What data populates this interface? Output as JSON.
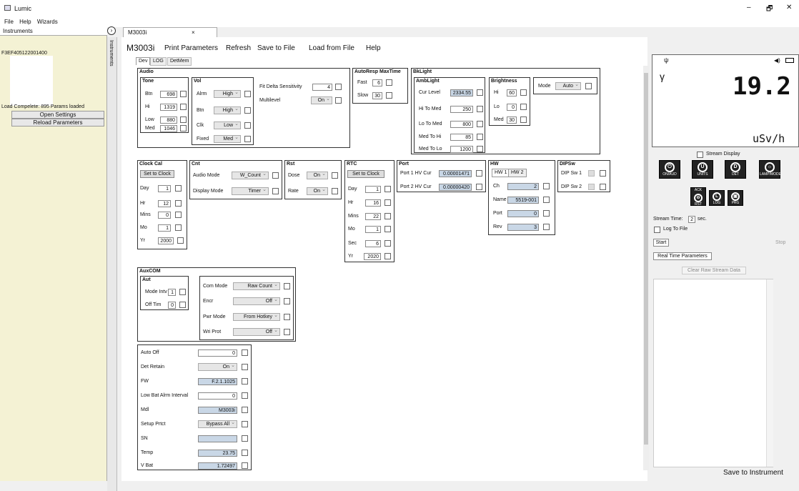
{
  "window": {
    "title": "Lumic",
    "minimize": "–",
    "restore": "🗗",
    "close": "✕"
  },
  "menu": [
    "File",
    "Help",
    "Wizards"
  ],
  "left": {
    "header": "Instruments",
    "serial": "F3EF405122001400",
    "status": "Load Compelete: 895 Params loaded",
    "open_settings": "Open Settings",
    "reload": "Reload Parameters",
    "strip_label": "Instruments"
  },
  "doc_tab": {
    "label": "M3003i",
    "close": "×"
  },
  "toolbar": {
    "model": "M3003i",
    "print": "Print Parameters",
    "refresh": "Refresh",
    "save_file": "Save to File",
    "load_file": "Load from File",
    "help": "Help"
  },
  "subtabs": [
    "Dev",
    "LOG",
    "DetMem"
  ],
  "audio": {
    "title": "Audio",
    "tone": {
      "title": "Tone",
      "rows": [
        {
          "label": "Btn",
          "value": "698"
        },
        {
          "label": "Hi",
          "value": "1319"
        },
        {
          "label": "Low",
          "value": "880"
        },
        {
          "label": "Med",
          "value": "1046"
        }
      ]
    },
    "vol": {
      "title": "Vol",
      "rows": [
        {
          "label": "Alrm",
          "value": "High"
        },
        {
          "label": "Btn",
          "value": "High"
        },
        {
          "label": "Clk",
          "value": "Low"
        },
        {
          "label": "Fixed",
          "value": "Med"
        }
      ]
    },
    "fit": {
      "label": "Fit Delta Sensitivity",
      "value": "4"
    },
    "multilevel": {
      "label": "Multilevel",
      "value": "On"
    }
  },
  "autoresp": {
    "title": "AutoResp MaxTime",
    "fast": {
      "label": "Fast",
      "value": "6"
    },
    "slow": {
      "label": "Slow",
      "value": "30"
    }
  },
  "bklight": {
    "title": "BkLight",
    "amb": {
      "title": "AmbLight",
      "rows": [
        {
          "label": "Cur Level",
          "value": "2334.55"
        },
        {
          "label": "Hi To Med",
          "value": "250"
        },
        {
          "label": "Lo To Med",
          "value": "800"
        },
        {
          "label": "Med To Hi",
          "value": "85"
        },
        {
          "label": "Med To Lo",
          "value": "1200"
        }
      ]
    },
    "bright": {
      "title": "Brightness",
      "rows": [
        {
          "label": "Hi",
          "value": "60"
        },
        {
          "label": "Lo",
          "value": "0"
        },
        {
          "label": "Med",
          "value": "30"
        }
      ]
    },
    "mode": {
      "label": "Mode",
      "value": "Auto"
    }
  },
  "clock": {
    "title": "Clock Cal",
    "set": "Set to Clock",
    "rows": [
      {
        "label": "Day",
        "value": "1"
      },
      {
        "label": "Hr",
        "value": "12"
      },
      {
        "label": "Mins",
        "value": "0"
      },
      {
        "label": "Mo",
        "value": "1"
      },
      {
        "label": "Yr",
        "value": "2000"
      }
    ]
  },
  "cnt": {
    "title": "Cnt",
    "audio": {
      "label": "Audio Mode",
      "value": "W_Count"
    },
    "display": {
      "label": "Display Mode",
      "value": "Timer"
    }
  },
  "rst": {
    "title": "Rst",
    "dose": {
      "label": "Dose",
      "value": "On"
    },
    "rate": {
      "label": "Rate",
      "value": "On"
    }
  },
  "rtc": {
    "title": "RTC",
    "set": "Set to Clock",
    "rows": [
      {
        "label": "Day",
        "value": "1"
      },
      {
        "label": "Hr",
        "value": "16"
      },
      {
        "label": "Mins",
        "value": "22"
      },
      {
        "label": "Mo",
        "value": "1"
      },
      {
        "label": "Sec",
        "value": "6"
      },
      {
        "label": "Yr",
        "value": "2020"
      }
    ]
  },
  "port": {
    "title": "Port",
    "p1": {
      "label": "Port 1 HV Cur",
      "value": "0.00001471"
    },
    "p2": {
      "label": "Port 2 HV Cur",
      "value": "0.00000420"
    }
  },
  "hw": {
    "title": "HW",
    "tab1": "HW 1",
    "tab2": "HW 2",
    "rows": [
      {
        "label": "Ch",
        "value": "2"
      },
      {
        "label": "Name",
        "value": "5519-001"
      },
      {
        "label": "Port",
        "value": "0"
      },
      {
        "label": "Rev",
        "value": "3"
      }
    ]
  },
  "dipsw": {
    "title": "DIPSw",
    "rows": [
      {
        "label": "DIP Sw 1"
      },
      {
        "label": "DIP Sw 2"
      }
    ]
  },
  "auxcom": {
    "title": "AuxCOM",
    "aut": {
      "title": "Aut",
      "mode": {
        "label": "Mode Intv",
        "value": "1"
      },
      "off": {
        "label": "Off Tim",
        "value": "0"
      }
    },
    "com": {
      "label": "Com Mode",
      "value": "Raw Count"
    },
    "encr": {
      "label": "Encr",
      "value": "Off"
    },
    "pwr": {
      "label": "Pwr Mode",
      "value": "From Hotkey"
    },
    "wri": {
      "label": "Wri Prot",
      "value": "Off"
    }
  },
  "misc": [
    {
      "label": "Auto Off",
      "value": "0",
      "kind": "input"
    },
    {
      "label": "Det Retain",
      "value": "On",
      "kind": "dd"
    },
    {
      "label": "FW",
      "value": "F.2.1.1025",
      "kind": "ro"
    },
    {
      "label": "Low Bat Alrm Interval",
      "value": "0",
      "kind": "input"
    },
    {
      "label": "Mdl",
      "value": "M3003i",
      "kind": "ro"
    },
    {
      "label": "Setup Prtct",
      "value": "Bypass All",
      "kind": "dd"
    },
    {
      "label": "SN",
      "value": "",
      "kind": "ro"
    },
    {
      "label": "Temp",
      "value": "23.75",
      "kind": "ro"
    },
    {
      "label": "V Bat",
      "value": "1.72497",
      "kind": "ro"
    }
  ],
  "display": {
    "symbol": "γ",
    "value": "19.2",
    "unit": "uSv/h"
  },
  "stream": {
    "display_label": "Stream Display",
    "time_label": "Stream Time:",
    "time_value": "2",
    "time_unit": "sec.",
    "log_label": "Log To File",
    "start": "Start",
    "stop": "Stop",
    "rt_params": "Real Time Parameters",
    "clear": "Clear Raw Stream Data"
  },
  "icons": {
    "onaud": "ON/AUD",
    "units": "UNITS",
    "det": "DET",
    "lamp": "LAMP/MODE",
    "ack": "ACK",
    "rst": "RST",
    "log": "LOG",
    "prg": "PRG"
  },
  "save": "Save to Instrument"
}
